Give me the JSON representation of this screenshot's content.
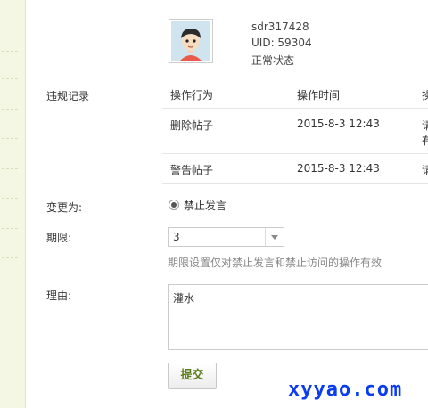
{
  "user": {
    "username": "sdr317428",
    "uid": "UID: 59304",
    "status": "正常状态"
  },
  "violations": {
    "label": "违规记录",
    "headers": [
      "操作行为",
      "操作时间",
      "操"
    ],
    "rows": [
      {
        "action": "删除帖子",
        "time": "2015-8-3 12:43",
        "extra1": "请",
        "extra2": "有"
      },
      {
        "action": "警告帖子",
        "time": "2015-8-3 12:43",
        "extra1": "请"
      }
    ]
  },
  "change": {
    "label": "变更为:",
    "option": "禁止发言"
  },
  "period": {
    "label": "期限:",
    "value": "3",
    "hint": "期限设置仅对禁止发言和禁止访问的操作有效"
  },
  "reason": {
    "label": "理由:",
    "value": "灌水"
  },
  "submit_label": "提交",
  "watermark": "xyyao.com"
}
